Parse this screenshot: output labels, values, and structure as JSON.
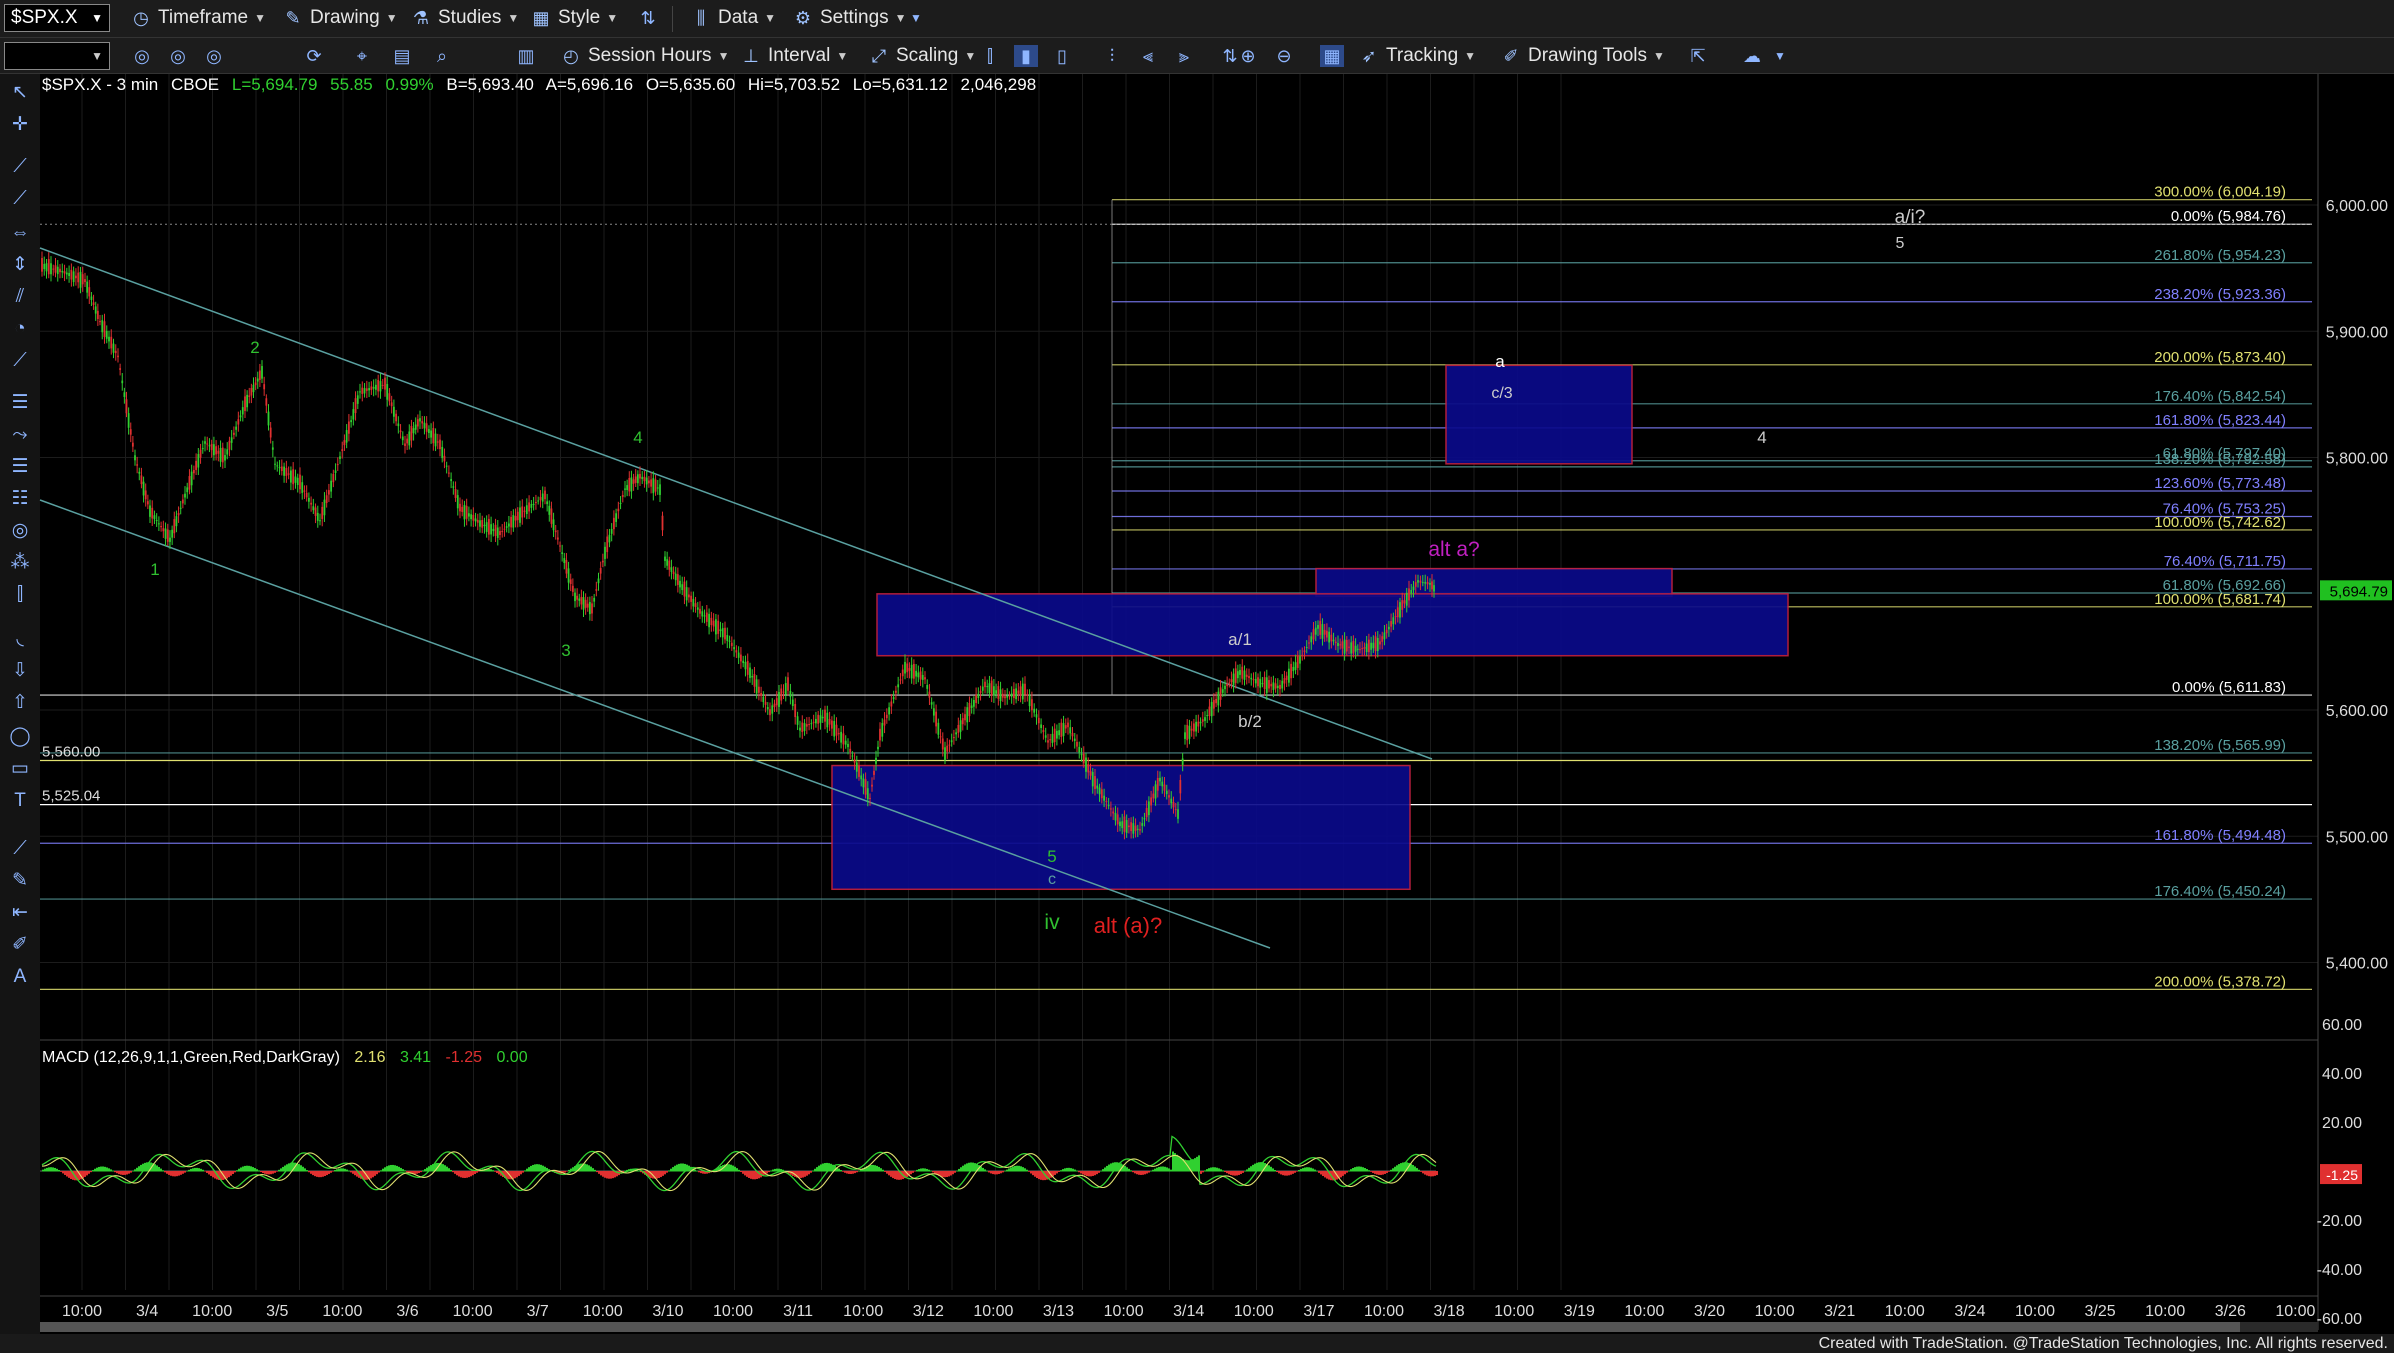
{
  "toolbar": {
    "symbol": "$SPX.X",
    "timeframe": "Timeframe",
    "drawing": "Drawing",
    "studies": "Studies",
    "style": "Style",
    "data": "Data",
    "settings": "Settings",
    "session_hours": "Session Hours",
    "interval": "Interval",
    "scaling": "Scaling",
    "tracking": "Tracking",
    "drawing_tools": "Drawing Tools"
  },
  "header": {
    "symbol_info": "$SPX.X - 3 min",
    "exchange": "CBOE",
    "last": "L=5,694.79",
    "change": "55.85",
    "change_pct": "0.99%",
    "bid": "B=5,693.40",
    "ask": "A=5,696.16",
    "open": "O=5,635.60",
    "high": "Hi=5,703.52",
    "low": "Lo=5,631.12",
    "volume": "2,046,298"
  },
  "price_axis": {
    "ticks": [
      {
        "label": "6,000.00",
        "value": 6000
      },
      {
        "label": "5,900.00",
        "value": 5900
      },
      {
        "label": "5,800.00",
        "value": 5800
      },
      {
        "label": "5,600.00",
        "value": 5600
      },
      {
        "label": "5,500.00",
        "value": 5500
      },
      {
        "label": "5,400.00",
        "value": 5400
      }
    ],
    "last_price": "5,694.79"
  },
  "time_axis": {
    "labels": [
      "10:00",
      "3/4",
      "10:00",
      "3/5",
      "10:00",
      "3/6",
      "10:00",
      "3/7",
      "10:00",
      "3/10",
      "10:00",
      "3/11",
      "10:00",
      "3/12",
      "10:00",
      "3/13",
      "10:00",
      "3/14",
      "10:00",
      "3/17",
      "10:00",
      "3/18",
      "10:00",
      "3/19",
      "10:00",
      "3/20",
      "10:00",
      "3/21",
      "10:00",
      "3/24",
      "10:00",
      "3/25",
      "10:00",
      "3/26",
      "10:00"
    ]
  },
  "fib_levels": [
    {
      "label": "300.00% (6,004.19)",
      "value": 6004.19,
      "color": "#e0e070"
    },
    {
      "label": "0.00% (5,984.76)",
      "value": 5984.76,
      "color": "#ffffff"
    },
    {
      "label": "261.80% (5,954.23)",
      "value": 5954.23,
      "color": "#5aa0a0"
    },
    {
      "label": "238.20% (5,923.36)",
      "value": 5923.36,
      "color": "#8080ff"
    },
    {
      "label": "200.00% (5,873.40)",
      "value": 5873.4,
      "color": "#e0e070"
    },
    {
      "label": "176.40% (5,842.54)",
      "value": 5842.54,
      "color": "#5aa0a0"
    },
    {
      "label": "161.80% (5,823.44)",
      "value": 5823.44,
      "color": "#8080ff"
    },
    {
      "label": "61.80% (5,797.40)",
      "value": 5797.4,
      "color": "#5aa0a0"
    },
    {
      "label": "138.20% (5,792.58)",
      "value": 5792.58,
      "color": "#5aa0a0"
    },
    {
      "label": "123.60% (5,773.48)",
      "value": 5773.48,
      "color": "#8080ff"
    },
    {
      "label": "76.40% (5,753.25)",
      "value": 5753.25,
      "color": "#8080ff"
    },
    {
      "label": "100.00% (5,742.62)",
      "value": 5742.62,
      "color": "#e0e070"
    },
    {
      "label": "76.40% (5,711.75)",
      "value": 5711.75,
      "color": "#8080ff"
    },
    {
      "label": "61.80% (5,692.66)",
      "value": 5692.66,
      "color": "#5aa0a0"
    },
    {
      "label": "100.00% (5,681.74)",
      "value": 5681.74,
      "color": "#e0e070"
    },
    {
      "label": "0.00% (5,611.83)",
      "value": 5611.83,
      "color": "#ffffff"
    },
    {
      "label": "138.20% (5,565.99)",
      "value": 5565.99,
      "color": "#5aa0a0"
    },
    {
      "label": "161.80% (5,494.48)",
      "value": 5494.48,
      "color": "#8080ff"
    },
    {
      "label": "176.40% (5,450.24)",
      "value": 5450.24,
      "color": "#5aa0a0"
    },
    {
      "label": "200.00% (5,378.72)",
      "value": 5378.72,
      "color": "#e0e070"
    }
  ],
  "horizontal_levels": [
    {
      "label": "5,560.00",
      "value": 5560,
      "color": "#e0e070"
    },
    {
      "label": "5,525.04",
      "value": 5525.04,
      "color": "#ffffff"
    }
  ],
  "wave_labels": [
    {
      "text": "1",
      "color": "#30c030"
    },
    {
      "text": "2",
      "color": "#30c030"
    },
    {
      "text": "3",
      "color": "#30c030"
    },
    {
      "text": "4",
      "color": "#30c030"
    },
    {
      "text": "5",
      "color": "#30c030"
    },
    {
      "text": "c",
      "color": "#5aa0a0"
    },
    {
      "text": "iv",
      "color": "#30c030"
    },
    {
      "text": "alt (a)?",
      "color": "#e02020"
    },
    {
      "text": "a/1",
      "color": "#cccccc"
    },
    {
      "text": "b/2",
      "color": "#cccccc"
    },
    {
      "text": "alt a?",
      "color": "#c020c0"
    },
    {
      "text": "a",
      "color": "#ffffff"
    },
    {
      "text": "c/3",
      "color": "#cccccc"
    },
    {
      "text": "4",
      "color": "#cccccc"
    },
    {
      "text": "a/i?",
      "color": "#cccccc"
    },
    {
      "text": "5",
      "color": "#cccccc"
    }
  ],
  "macd": {
    "title": "MACD (12,26,9,1,1,Green,Red,DarkGray)",
    "v1": "2.16",
    "v2": "3.41",
    "v3": "-1.25",
    "v4": "0.00",
    "ticks": [
      "60.00",
      "40.00",
      "20.00",
      "-20.00",
      "-40.00",
      "-60.00"
    ],
    "current": "-1.25"
  },
  "footer": "Created with TradeStation. @TradeStation Technologies, Inc. All rights reserved.",
  "colors": {
    "bull": "#30d030",
    "bear": "#e03030",
    "channel": "#5aa0a0",
    "box_fill": "#0a0a8a",
    "box_border": "#c02040",
    "last_price_bg": "#20c020"
  }
}
